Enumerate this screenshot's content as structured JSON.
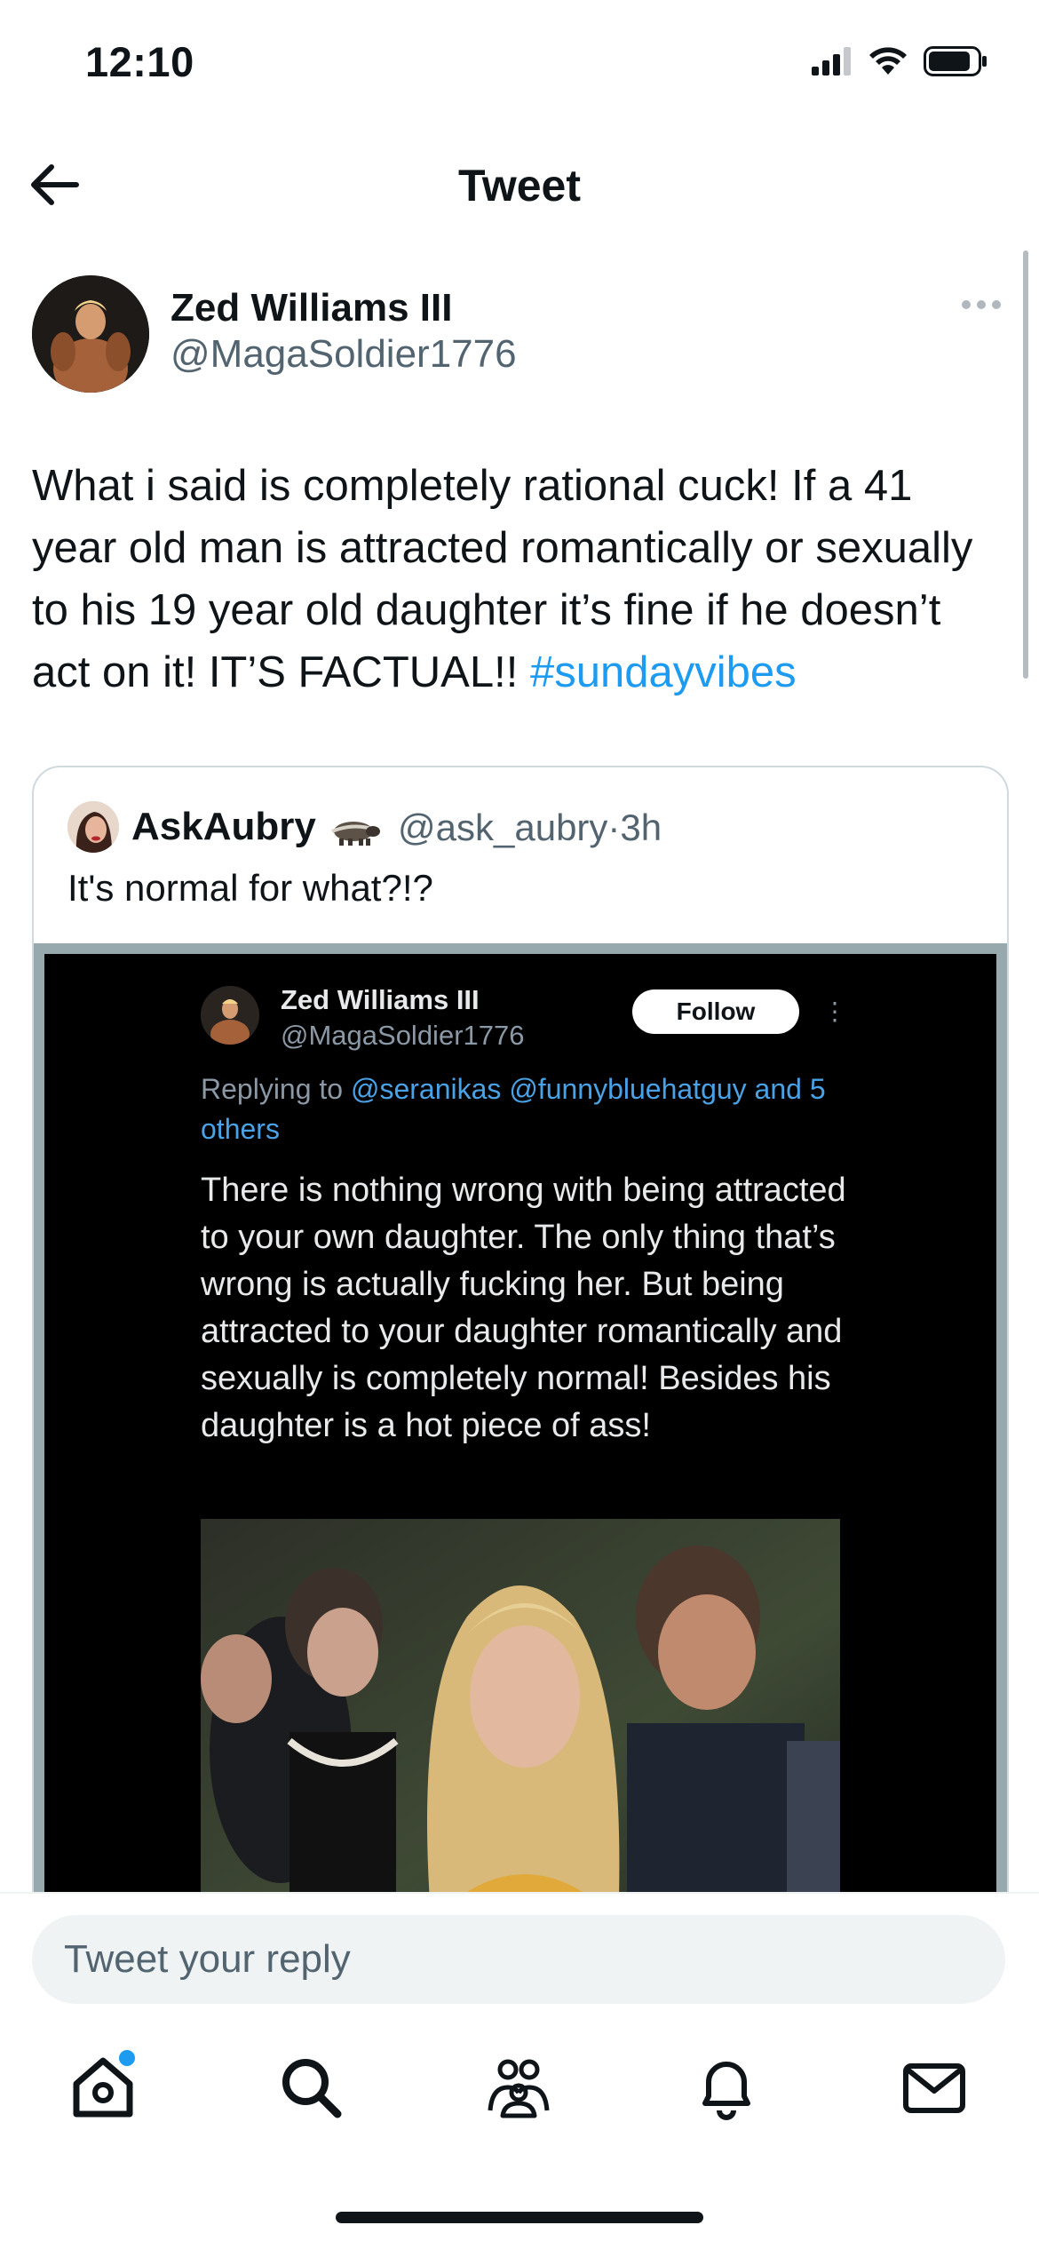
{
  "status_bar": {
    "time": "12:10"
  },
  "nav": {
    "title": "Tweet"
  },
  "tweet": {
    "author_name": "Zed Williams III",
    "author_handle": "@MagaSoldier1776",
    "text": "What i said is completely rational cuck! If a 41 year old man is attracted romantically or sexually to his 19 year old daughter it’s fine if he doesn’t act on it! IT’S FACTUAL!! ",
    "hashtag": "#sundayvibes"
  },
  "quoted_tweet": {
    "author_name": "AskAubry",
    "author_handle": "@ask_aubry",
    "separator": "·",
    "time": "3h",
    "text": "It's normal for what?!?"
  },
  "screenshot": {
    "author_name": "Zed Williams III",
    "author_handle": "@MagaSoldier1776",
    "follow_label": "Follow",
    "replying_prefix": "Replying to ",
    "replying_mentions": "@seranikas @funnybluehatguy and 5 others",
    "text": "There is nothing wrong with being attracted to your own daughter. The only thing that’s wrong is actually fucking her. But being attracted to your daughter romantically and sexually is completely normal! Besides his daughter is a hot piece of ass!"
  },
  "reply": {
    "placeholder": "Tweet your reply"
  },
  "tabs": [
    {
      "icon": "home-icon"
    },
    {
      "icon": "search-icon"
    },
    {
      "icon": "communities-icon"
    },
    {
      "icon": "notifications-icon"
    },
    {
      "icon": "messages-icon"
    }
  ],
  "colors": {
    "accent": "#1d9bf0",
    "secondary_text": "#536471",
    "text": "#0f1419"
  }
}
